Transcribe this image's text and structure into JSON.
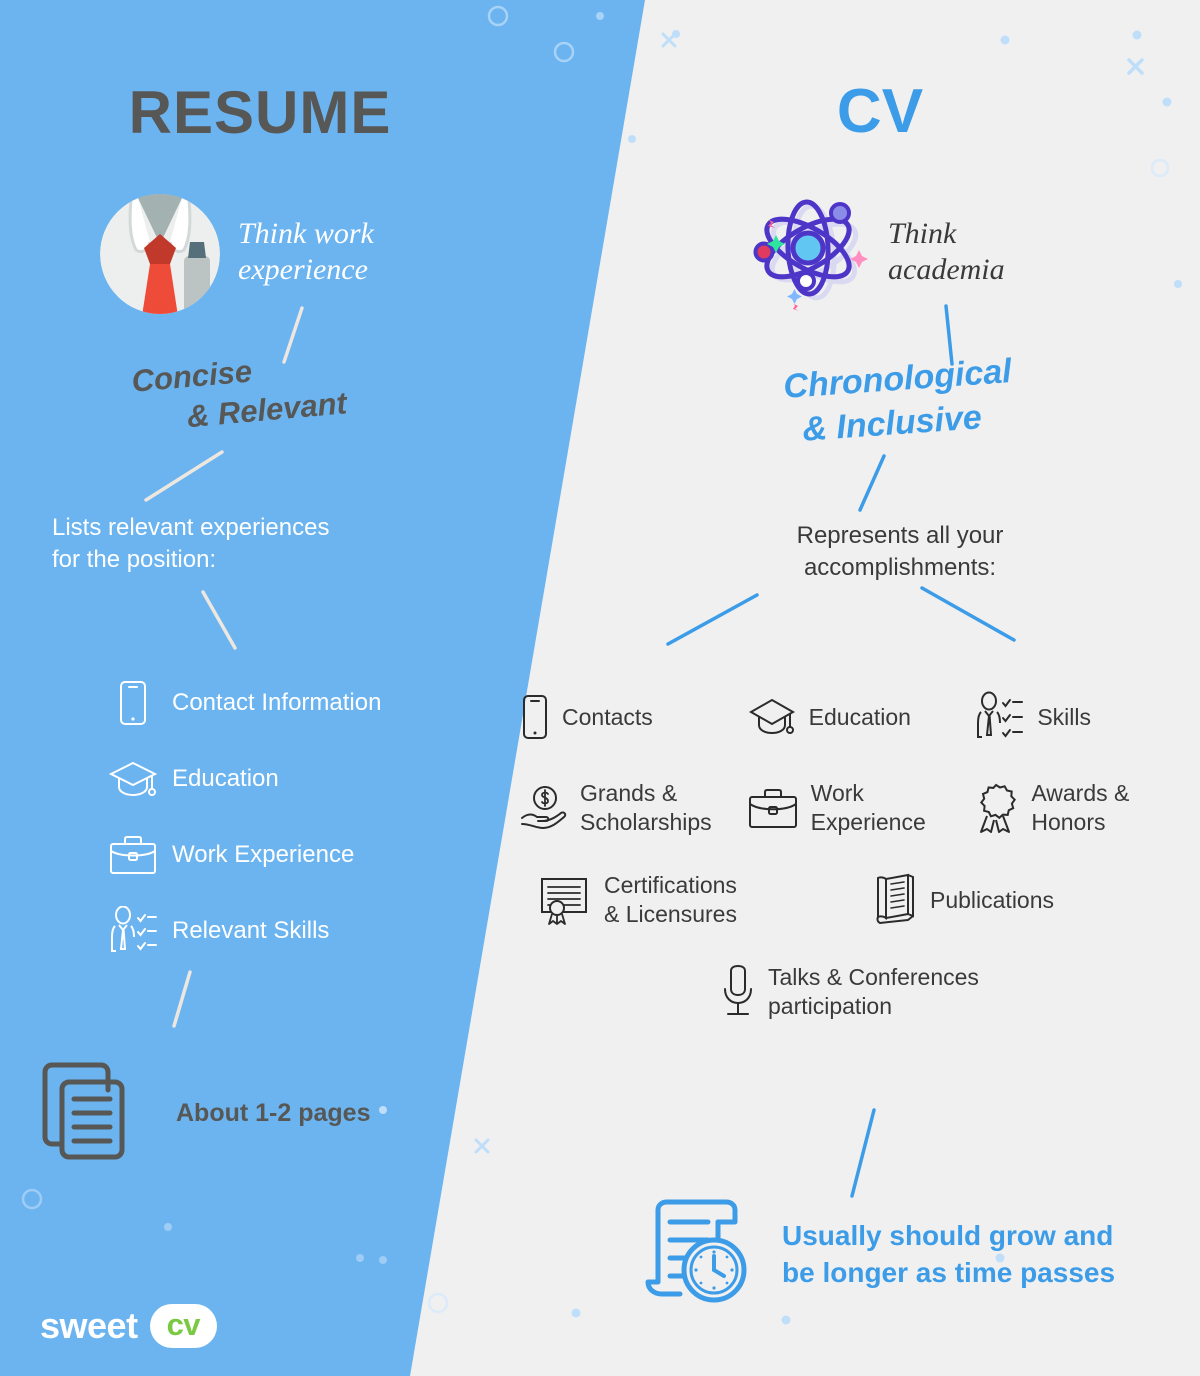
{
  "colors": {
    "left_bg": "#6BB4F0",
    "right_bg": "#F0F0F0",
    "dark_gray": "#575756",
    "cv_blue": "#3C9CE8",
    "logo_green": "#7AC943",
    "white": "#FFFFFF",
    "deco_blue": "#BFDEFA",
    "connector_left": "#EDE7E0",
    "tie_red": "#EE4B39"
  },
  "left": {
    "title": "RESUME",
    "shirt_icon": "shirt-tie-icon",
    "tagline": "Think work experience",
    "tagline_lines": [
      "Think work",
      "experience"
    ],
    "style_note_lines": [
      "Concise",
      "& Relevant"
    ],
    "intro_lines": [
      "Lists relevant experiences",
      "for the position:"
    ],
    "sections": [
      {
        "label": "Contact Information",
        "icon": "mobile-phone-icon"
      },
      {
        "label": "Education",
        "icon": "graduation-cap-icon"
      },
      {
        "label": "Work Experience",
        "icon": "briefcase-icon"
      },
      {
        "label": "Relevant Skills",
        "icon": "person-checklist-icon"
      }
    ],
    "length_note": "About 1-2 pages",
    "length_icon": "stacked-documents-icon",
    "logo": {
      "word": "sweet",
      "pill": "cv"
    }
  },
  "right": {
    "title": "CV",
    "atom_icon": "atom-icon",
    "tagline_lines": [
      "Think",
      "academia"
    ],
    "style_note_lines": [
      "Chronological",
      "& Inclusive"
    ],
    "intro_lines": [
      "Represents all your",
      "accomplishments:"
    ],
    "sections": [
      {
        "label": "Contacts",
        "lines": [
          "Contacts"
        ],
        "icon": "mobile-phone-icon"
      },
      {
        "label": "Education",
        "lines": [
          "Education"
        ],
        "icon": "graduation-cap-icon"
      },
      {
        "label": "Skills",
        "lines": [
          "Skills"
        ],
        "icon": "person-checklist-icon"
      },
      {
        "label": "Grands & Scholarships",
        "lines": [
          "Grands &",
          "Scholarships"
        ],
        "icon": "hand-coin-icon"
      },
      {
        "label": "Work Experience",
        "lines": [
          "Work",
          "Experience"
        ],
        "icon": "briefcase-icon"
      },
      {
        "label": "Awards & Honors",
        "lines": [
          "Awards &",
          "Honors"
        ],
        "icon": "award-rosette-icon"
      },
      {
        "label": "Certifications & Licensures",
        "lines": [
          "Certifications",
          "& Licensures"
        ],
        "icon": "certificate-icon"
      },
      {
        "label": "Publications",
        "lines": [
          "Publications"
        ],
        "icon": "open-book-icon"
      },
      {
        "label": "Talks & Conferences participation",
        "lines": [
          "Talks & Conferences",
          "participation"
        ],
        "icon": "microphone-icon"
      }
    ],
    "growth_note_lines": [
      "Usually should grow and",
      "be longer as time passes"
    ],
    "growth_icon": "scroll-clock-icon"
  }
}
